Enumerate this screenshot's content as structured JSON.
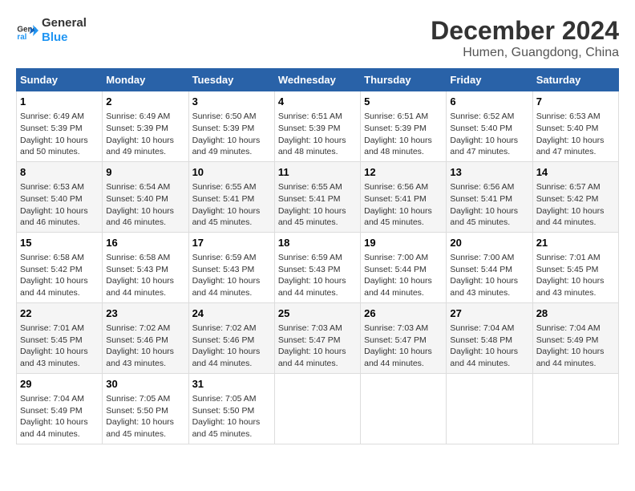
{
  "logo": {
    "line1": "General",
    "line2": "Blue"
  },
  "title": "December 2024",
  "location": "Humen, Guangdong, China",
  "days_of_week": [
    "Sunday",
    "Monday",
    "Tuesday",
    "Wednesday",
    "Thursday",
    "Friday",
    "Saturday"
  ],
  "weeks": [
    [
      {
        "num": "1",
        "info": "Sunrise: 6:49 AM\nSunset: 5:39 PM\nDaylight: 10 hours\nand 50 minutes."
      },
      {
        "num": "2",
        "info": "Sunrise: 6:49 AM\nSunset: 5:39 PM\nDaylight: 10 hours\nand 49 minutes."
      },
      {
        "num": "3",
        "info": "Sunrise: 6:50 AM\nSunset: 5:39 PM\nDaylight: 10 hours\nand 49 minutes."
      },
      {
        "num": "4",
        "info": "Sunrise: 6:51 AM\nSunset: 5:39 PM\nDaylight: 10 hours\nand 48 minutes."
      },
      {
        "num": "5",
        "info": "Sunrise: 6:51 AM\nSunset: 5:39 PM\nDaylight: 10 hours\nand 48 minutes."
      },
      {
        "num": "6",
        "info": "Sunrise: 6:52 AM\nSunset: 5:40 PM\nDaylight: 10 hours\nand 47 minutes."
      },
      {
        "num": "7",
        "info": "Sunrise: 6:53 AM\nSunset: 5:40 PM\nDaylight: 10 hours\nand 47 minutes."
      }
    ],
    [
      {
        "num": "8",
        "info": "Sunrise: 6:53 AM\nSunset: 5:40 PM\nDaylight: 10 hours\nand 46 minutes."
      },
      {
        "num": "9",
        "info": "Sunrise: 6:54 AM\nSunset: 5:40 PM\nDaylight: 10 hours\nand 46 minutes."
      },
      {
        "num": "10",
        "info": "Sunrise: 6:55 AM\nSunset: 5:41 PM\nDaylight: 10 hours\nand 45 minutes."
      },
      {
        "num": "11",
        "info": "Sunrise: 6:55 AM\nSunset: 5:41 PM\nDaylight: 10 hours\nand 45 minutes."
      },
      {
        "num": "12",
        "info": "Sunrise: 6:56 AM\nSunset: 5:41 PM\nDaylight: 10 hours\nand 45 minutes."
      },
      {
        "num": "13",
        "info": "Sunrise: 6:56 AM\nSunset: 5:41 PM\nDaylight: 10 hours\nand 45 minutes."
      },
      {
        "num": "14",
        "info": "Sunrise: 6:57 AM\nSunset: 5:42 PM\nDaylight: 10 hours\nand 44 minutes."
      }
    ],
    [
      {
        "num": "15",
        "info": "Sunrise: 6:58 AM\nSunset: 5:42 PM\nDaylight: 10 hours\nand 44 minutes."
      },
      {
        "num": "16",
        "info": "Sunrise: 6:58 AM\nSunset: 5:43 PM\nDaylight: 10 hours\nand 44 minutes."
      },
      {
        "num": "17",
        "info": "Sunrise: 6:59 AM\nSunset: 5:43 PM\nDaylight: 10 hours\nand 44 minutes."
      },
      {
        "num": "18",
        "info": "Sunrise: 6:59 AM\nSunset: 5:43 PM\nDaylight: 10 hours\nand 44 minutes."
      },
      {
        "num": "19",
        "info": "Sunrise: 7:00 AM\nSunset: 5:44 PM\nDaylight: 10 hours\nand 44 minutes."
      },
      {
        "num": "20",
        "info": "Sunrise: 7:00 AM\nSunset: 5:44 PM\nDaylight: 10 hours\nand 43 minutes."
      },
      {
        "num": "21",
        "info": "Sunrise: 7:01 AM\nSunset: 5:45 PM\nDaylight: 10 hours\nand 43 minutes."
      }
    ],
    [
      {
        "num": "22",
        "info": "Sunrise: 7:01 AM\nSunset: 5:45 PM\nDaylight: 10 hours\nand 43 minutes."
      },
      {
        "num": "23",
        "info": "Sunrise: 7:02 AM\nSunset: 5:46 PM\nDaylight: 10 hours\nand 43 minutes."
      },
      {
        "num": "24",
        "info": "Sunrise: 7:02 AM\nSunset: 5:46 PM\nDaylight: 10 hours\nand 44 minutes."
      },
      {
        "num": "25",
        "info": "Sunrise: 7:03 AM\nSunset: 5:47 PM\nDaylight: 10 hours\nand 44 minutes."
      },
      {
        "num": "26",
        "info": "Sunrise: 7:03 AM\nSunset: 5:47 PM\nDaylight: 10 hours\nand 44 minutes."
      },
      {
        "num": "27",
        "info": "Sunrise: 7:04 AM\nSunset: 5:48 PM\nDaylight: 10 hours\nand 44 minutes."
      },
      {
        "num": "28",
        "info": "Sunrise: 7:04 AM\nSunset: 5:49 PM\nDaylight: 10 hours\nand 44 minutes."
      }
    ],
    [
      {
        "num": "29",
        "info": "Sunrise: 7:04 AM\nSunset: 5:49 PM\nDaylight: 10 hours\nand 44 minutes."
      },
      {
        "num": "30",
        "info": "Sunrise: 7:05 AM\nSunset: 5:50 PM\nDaylight: 10 hours\nand 45 minutes."
      },
      {
        "num": "31",
        "info": "Sunrise: 7:05 AM\nSunset: 5:50 PM\nDaylight: 10 hours\nand 45 minutes."
      },
      {
        "num": "",
        "info": ""
      },
      {
        "num": "",
        "info": ""
      },
      {
        "num": "",
        "info": ""
      },
      {
        "num": "",
        "info": ""
      }
    ]
  ]
}
